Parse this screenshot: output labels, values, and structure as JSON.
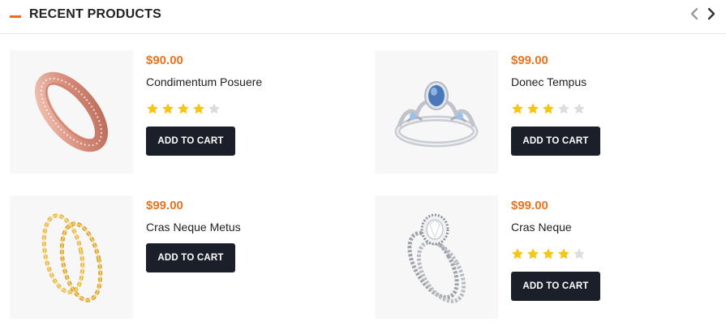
{
  "section": {
    "title": "RECENT PRODUCTS",
    "accent_color": "#f26b1d",
    "nav_prev_icon": "chevron-left-icon",
    "nav_next_icon": "chevron-right-icon"
  },
  "products": [
    {
      "price": "$90.00",
      "name": "Condimentum Posuere",
      "rating": 4,
      "max_rating": 5,
      "cart_label": "ADD TO CART",
      "image": "rose-gold-diamond-band-ring"
    },
    {
      "price": "$99.00",
      "name": "Donec Tempus",
      "rating": 3,
      "max_rating": 5,
      "cart_label": "ADD TO CART",
      "image": "blue-sapphire-tiara-ring"
    },
    {
      "price": "$99.00",
      "name": "Cras Neque Metus",
      "rating": 0,
      "max_rating": 5,
      "cart_label": "ADD TO CART",
      "image": "gold-floral-stacking-rings"
    },
    {
      "price": "$99.00",
      "name": "Cras Neque",
      "rating": 4,
      "max_rating": 5,
      "cart_label": "ADD TO CART",
      "image": "diamond-halo-bridal-set"
    }
  ],
  "colors": {
    "price": "#e8741f",
    "star_filled": "#f5c518",
    "star_empty": "#dddddd",
    "button_bg": "#1b1f2a"
  }
}
